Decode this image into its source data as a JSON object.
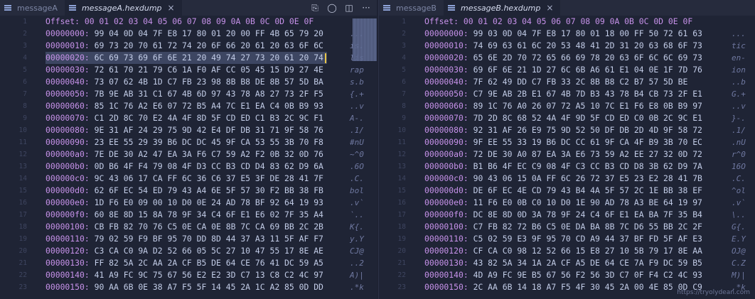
{
  "left": {
    "tabs": [
      {
        "label": "messageA",
        "active": false
      },
      {
        "label": "messageA.hexdump",
        "active": true,
        "close": "×"
      }
    ],
    "actions": [
      "⎘",
      "◯",
      "◫",
      "···"
    ],
    "header": "Offset: 00 01 02 03 04 05 06 07 08 09 0A 0B 0C 0D 0E 0F",
    "rows": [
      {
        "addr": "00000000:",
        "bytes": "99 04 0D 04 7F E8 17 80 01 20 00 FF 4B 65 79 20",
        "ascii": "..."
      },
      {
        "addr": "00000010:",
        "bytes": "69 73 20 70 61 72 74 20 6F 66 20 61 20 63 6F 6C",
        "ascii": "is."
      },
      {
        "addr": "00000020:",
        "bytes": "6C 69 73 69 6F 6E 21 20 49 74 27 73 20 61 20 74",
        "ascii": "lis"
      },
      {
        "addr": "00000030:",
        "bytes": "72 61 70 21 79 C6 1A F0 AF CC 05 45 15 D9 27 4E",
        "ascii": "rap"
      },
      {
        "addr": "00000040:",
        "bytes": "73 07 62 4B 1D C7 FB 23 98 8B B8 DE 8B 57 5D BA",
        "ascii": "s.b"
      },
      {
        "addr": "00000050:",
        "bytes": "7B 9E AB 31 C1 67 4B 6D 97 43 78 A8 27 73 2F F5",
        "ascii": "{.+"
      },
      {
        "addr": "00000060:",
        "bytes": "85 1C 76 A2 E6 07 72 B5 A4 7C E1 EA C4 0B B9 93",
        "ascii": "..v"
      },
      {
        "addr": "00000070:",
        "bytes": "C1 2D 8C 70 E2 4A 4F 8D 5F CD ED C1 B3 2C 9C F1",
        "ascii": "A-."
      },
      {
        "addr": "00000080:",
        "bytes": "9E 31 AF 24 29 75 9D 42 E4 DF DB 31 71 9F 58 76",
        "ascii": ".1/"
      },
      {
        "addr": "00000090:",
        "bytes": "23 EE 55 29 39 B6 DC DC 45 9F CA 53 55 3B 70 F8",
        "ascii": "#nU"
      },
      {
        "addr": "000000a0:",
        "bytes": "7E DE 30 A2 47 EA 3A F6 C7 59 A2 F2 0B 32 0D 76",
        "ascii": "~^0"
      },
      {
        "addr": "000000b0:",
        "bytes": "0D B6 4F F4 79 08 4F D3 CC B3 CD D4 83 62 D9 6A",
        "ascii": ".6O"
      },
      {
        "addr": "000000c0:",
        "bytes": "9C 43 06 17 CA FF 6C 36 C6 37 E5 3F DE 28 41 7F",
        "ascii": ".C."
      },
      {
        "addr": "000000d0:",
        "bytes": "62 6F EC 54 ED 79 43 A4 6E 5F 57 30 F2 BB 38 FB",
        "ascii": "bol"
      },
      {
        "addr": "000000e0:",
        "bytes": "1D F6 E0 09 00 10 D0 0E 24 AD 78 BF 92 64 19 93",
        "ascii": ".v`"
      },
      {
        "addr": "000000f0:",
        "bytes": "60 8E 8D 15 8A 78 9F 34 C4 6F E1 E6 02 7F 35 A4",
        "ascii": "`.."
      },
      {
        "addr": "00000100:",
        "bytes": "CB FB 82 70 76 C5 0E CA 0E 8B 7C CA 69 BB 2C 2B",
        "ascii": "K{."
      },
      {
        "addr": "00000110:",
        "bytes": "79 02 59 F9 BF 95 70 DD 8D 44 37 A3 11 5F AF F7",
        "ascii": "y.Y"
      },
      {
        "addr": "00000120:",
        "bytes": "C3 CA C0 9A D2 52 66 05 5C 27 10 47 55 17 8E AE",
        "ascii": "CJ@"
      },
      {
        "addr": "00000130:",
        "bytes": "FF 82 5A 2C AA 2A CF B5 DE 64 CE 76 41 DC 59 A5",
        "ascii": "..2"
      },
      {
        "addr": "00000140:",
        "bytes": "41 A9 FC 9C 75 67 56 E2 E2 3D C7 13 C8 C2 4C 97",
        "ascii": "A)|"
      },
      {
        "addr": "00000150:",
        "bytes": "90 AA 6B 0E 38 A7 F5 5F 14 45 2A 1C A2 85 0D DD",
        "ascii": ".*k"
      }
    ]
  },
  "right": {
    "tabs": [
      {
        "label": "messageB",
        "active": false
      },
      {
        "label": "messageB.hexdump",
        "active": true,
        "close": "×"
      }
    ],
    "header": "Offset: 00 01 02 03 04 05 06 07 08 09 0A 0B 0C 0D 0E 0F",
    "rows": [
      {
        "addr": "00000000:",
        "bytes": "99 03 0D 04 7F E8 17 80 01 18 00 FF 50 72 61 63",
        "ascii": "..."
      },
      {
        "addr": "00000010:",
        "bytes": "74 69 63 61 6C 20 53 48 41 2D 31 20 63 68 6F 73",
        "ascii": "tic"
      },
      {
        "addr": "00000020:",
        "bytes": "65 6E 2D 70 72 65 66 69 78 20 63 6F 6C 6C 69 73",
        "ascii": "en-"
      },
      {
        "addr": "00000030:",
        "bytes": "69 6F 6E 21 1D 27 6C 6B A6 61 E1 04 0E 1F 7D 76",
        "ascii": "ion"
      },
      {
        "addr": "00000040:",
        "bytes": "7F 62 49 DD C7 FB 33 2C 8B B8 C2 B7 57 5D BE",
        "ascii": "..b"
      },
      {
        "addr": "00000050:",
        "bytes": "C7 9E AB 2B E1 67 4B 7D B3 43 78 B4 CB 73 2F E1",
        "ascii": "G.+"
      },
      {
        "addr": "00000060:",
        "bytes": "89 1C 76 A0 26 07 72 A5 10 7C E1 F6 E8 0B B9 97",
        "ascii": "..v"
      },
      {
        "addr": "00000070:",
        "bytes": "7D 2D 8C 68 52 4A 4F 9D 5F CD ED C0 0B 2C 9C E1",
        "ascii": "}-."
      },
      {
        "addr": "00000080:",
        "bytes": "92 31 AF 26 E9 75 9D 52 50 DF DB 2D 4D 9F 58 72",
        "ascii": ".1/"
      },
      {
        "addr": "00000090:",
        "bytes": "9F EE 55 33 19 B6 DC CC 61 9F CA 4F B9 3B 70 EC",
        "ascii": ".nU"
      },
      {
        "addr": "000000a0:",
        "bytes": "72 DE 30 A0 87 EA 3A E6 73 59 A2 EE 27 32 0D 72",
        "ascii": "r^0"
      },
      {
        "addr": "000000b0:",
        "bytes": "B1 B6 4F EC C9 08 4F C3 CC B3 CD D8 3B 62 D9 7A",
        "ascii": "16O"
      },
      {
        "addr": "000000c0:",
        "bytes": "90 43 06 15 0A FF 6C 26 72 37 E5 23 E2 28 41 7B",
        "ascii": ".C."
      },
      {
        "addr": "000000d0:",
        "bytes": "DE 6F EC 4E CD 79 43 B4 4A 5F 57 2C 1E BB 38 EF",
        "ascii": "^ol"
      },
      {
        "addr": "000000e0:",
        "bytes": "11 F6 E0 0B C0 10 D0 1E 90 AD 78 A3 BE 64 19 97",
        "ascii": ".v`"
      },
      {
        "addr": "000000f0:",
        "bytes": "DC 8E 8D 0D 3A 78 9F 24 C4 6F E1 EA BA 7F 35 B4",
        "ascii": "\\.."
      },
      {
        "addr": "00000100:",
        "bytes": "C7 FB 82 72 B6 C5 0E DA BA 8B 7C D6 55 BB 2C 2F",
        "ascii": "G{."
      },
      {
        "addr": "00000110:",
        "bytes": "C5 02 59 E3 9F 95 70 CD A9 44 37 BF FD 5F AF E3",
        "ascii": "E.Y"
      },
      {
        "addr": "00000120:",
        "bytes": "CF CA C0 98 12 52 66 15 E8 27 10 5B 79 17 8E AA",
        "ascii": "OJ@"
      },
      {
        "addr": "00000130:",
        "bytes": "43 82 5A 34 1A 2A CF A5 DE 64 CE 7A F9 DC 59 B5",
        "ascii": "C.Z"
      },
      {
        "addr": "00000140:",
        "bytes": "4D A9 FC 9E B5 67 56 F2 56 3D C7 0F F4 C2 4C 93",
        "ascii": "M)|"
      },
      {
        "addr": "00000150:",
        "bytes": "2C AA 6B 14 18 A7 F5 4F 30 45 2A 00 4E 85 0D C9",
        "ascii": ",*k"
      }
    ]
  },
  "watermark": "https://tryolydean.com",
  "colors": {
    "address": "#c792ea",
    "bytes": "#c3cde8",
    "background": "#1f2435",
    "cursor": "#e8c547"
  }
}
